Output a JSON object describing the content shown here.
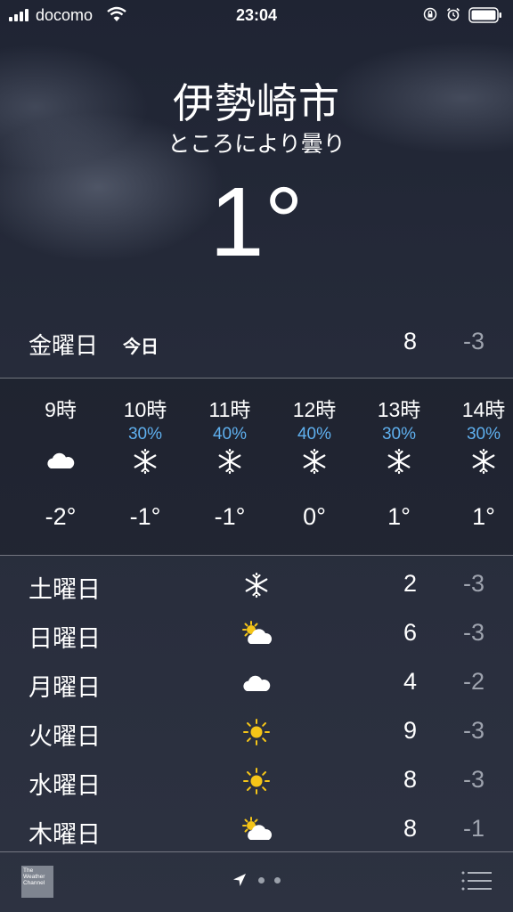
{
  "status_bar": {
    "carrier": "docomo",
    "time": "23:04",
    "icons": [
      "signal-icon",
      "wifi-icon",
      "rotation-lock-icon",
      "alarm-icon",
      "battery-icon"
    ]
  },
  "location": {
    "city": "伊勢崎市",
    "condition": "ところにより曇り",
    "temperature": "1°"
  },
  "today": {
    "day": "金曜日",
    "label": "今日",
    "high": "8",
    "low": "-3"
  },
  "hourly": [
    {
      "hour": "9時",
      "precip": "",
      "icon": "cloud-icon",
      "temp": "-2°"
    },
    {
      "hour": "10時",
      "precip": "30%",
      "icon": "snow-icon",
      "temp": "-1°"
    },
    {
      "hour": "11時",
      "precip": "40%",
      "icon": "snow-icon",
      "temp": "-1°"
    },
    {
      "hour": "12時",
      "precip": "40%",
      "icon": "snow-icon",
      "temp": "0°"
    },
    {
      "hour": "13時",
      "precip": "30%",
      "icon": "snow-icon",
      "temp": "1°"
    },
    {
      "hour": "14時",
      "precip": "30%",
      "icon": "snow-icon",
      "temp": "1°"
    }
  ],
  "daily": [
    {
      "day": "土曜日",
      "icon": "snow-icon",
      "high": "2",
      "low": "-3"
    },
    {
      "day": "日曜日",
      "icon": "partly-cloudy-icon",
      "high": "6",
      "low": "-3"
    },
    {
      "day": "月曜日",
      "icon": "cloud-icon",
      "high": "4",
      "low": "-2"
    },
    {
      "day": "火曜日",
      "icon": "sun-icon",
      "high": "9",
      "low": "-3"
    },
    {
      "day": "水曜日",
      "icon": "sun-icon",
      "high": "8",
      "low": "-3"
    },
    {
      "day": "木曜日",
      "icon": "partly-cloudy-icon",
      "high": "8",
      "low": "-1"
    }
  ],
  "bottom_bar": {
    "logo_text": "The Weather Channel",
    "pages": 3,
    "current_page": 1
  },
  "colors": {
    "precip": "#5fb0ef",
    "low_temp": "#9ea3ae",
    "sun": "#f5c518"
  }
}
